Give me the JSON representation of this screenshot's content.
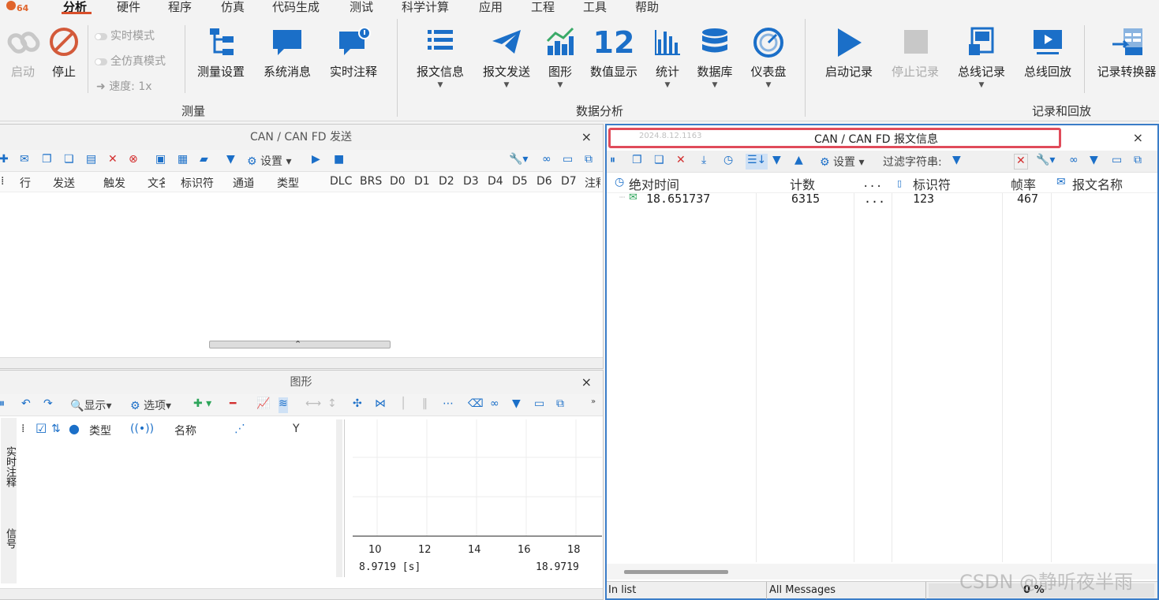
{
  "menu": {
    "items": [
      "分析",
      "硬件",
      "程序",
      "仿真",
      "代码生成",
      "测试",
      "科学计算",
      "应用",
      "工程",
      "工具",
      "帮助"
    ],
    "active": "分析"
  },
  "ribbon": {
    "measure": {
      "start": "启动",
      "stop": "停止",
      "realtime_mode": "实时模式",
      "full_sim_mode": "全仿真模式",
      "speed": "速度: 1x",
      "setup": "测量设置",
      "system_msg": "系统消息",
      "realtime_note": "实时注释",
      "group_label": "测量"
    },
    "analysis": {
      "msg_info": "报文信息",
      "msg_send": "报文发送",
      "graph": "图形",
      "numeric_icon": "12",
      "numeric": "数值显示",
      "stats": "统计",
      "database": "数据库",
      "dashboard": "仪表盘",
      "group_label": "数据分析"
    },
    "record": {
      "start_rec": "启动记录",
      "stop_rec": "停止记录",
      "bus_rec": "总线记录",
      "bus_replay": "总线回放",
      "converter": "记录转换器",
      "group_label": "记录和回放"
    }
  },
  "send_panel": {
    "title": "CAN / CAN FD 发送",
    "close": "×",
    "settings": "设置",
    "columns": [
      "行",
      "发送",
      "触发",
      "文名",
      "标识符",
      "通道",
      "类型",
      "DLC",
      "BRS",
      "D0",
      "D1",
      "D2",
      "D3",
      "D4",
      "D5",
      "D6",
      "D7",
      "注释"
    ]
  },
  "graph_panel": {
    "title": "图形",
    "close": "×",
    "display": "显示",
    "options": "选项",
    "columns": {
      "type": "类型",
      "name": "名称",
      "y": "Y"
    },
    "side_tabs": [
      "实时注释",
      "信号"
    ],
    "x_ticks": [
      "10",
      "12",
      "14",
      "16",
      "18"
    ],
    "range_start": "8.9719 [s]",
    "range_end": "18.9719"
  },
  "msg_panel": {
    "title": "CAN / CAN FD 报文信息",
    "watermark_date": "2024.8.12.1163",
    "close": "×",
    "settings": "设置",
    "filter_label": "过滤字符串:",
    "columns": {
      "abs_time": "绝对时间",
      "count": "计数",
      "dots": "...",
      "id": "标识符",
      "rate": "帧率",
      "msg_name": "报文名称"
    },
    "rows": [
      {
        "abs_time": "18.651737",
        "count": "6315",
        "dots": "...",
        "id": "123",
        "rate": "467",
        "msg_name": ""
      }
    ],
    "status_left": "In list",
    "status_mid": "All Messages",
    "status_right": "0 %"
  },
  "watermark": "CSDN @静听夜半雨",
  "colors": {
    "accent": "#1b6fc8",
    "red": "#d32f2f",
    "highlight_border": "#e04b5a",
    "menu_underline": "#d94f2b"
  }
}
